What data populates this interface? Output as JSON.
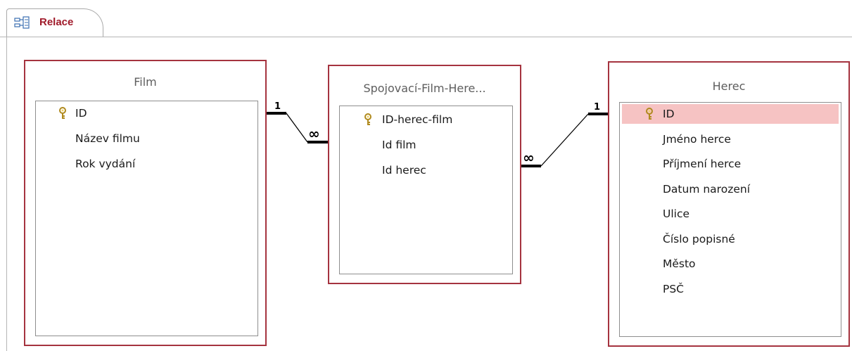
{
  "tab": {
    "label": "Relace"
  },
  "tables": {
    "film": {
      "title": "Film",
      "fields": [
        {
          "name": "ID",
          "key": true,
          "selected": false
        },
        {
          "name": "Název filmu",
          "key": false,
          "selected": false
        },
        {
          "name": "Rok vydání",
          "key": false,
          "selected": false
        }
      ]
    },
    "junction": {
      "title": "Spojovací-Film-Here...",
      "fields": [
        {
          "name": "ID-herec-film",
          "key": true,
          "selected": false
        },
        {
          "name": "Id film",
          "key": false,
          "selected": false
        },
        {
          "name": "Id herec",
          "key": false,
          "selected": false
        }
      ]
    },
    "herec": {
      "title": "Herec",
      "fields": [
        {
          "name": "ID",
          "key": true,
          "selected": true
        },
        {
          "name": "Jméno herce",
          "key": false,
          "selected": false
        },
        {
          "name": "Příjmení herce",
          "key": false,
          "selected": false
        },
        {
          "name": "Datum narození",
          "key": false,
          "selected": false
        },
        {
          "name": "Ulice",
          "key": false,
          "selected": false
        },
        {
          "name": "Číslo popisné",
          "key": false,
          "selected": false
        },
        {
          "name": "Město",
          "key": false,
          "selected": false
        },
        {
          "name": "PSČ",
          "key": false,
          "selected": false
        }
      ]
    }
  },
  "relationships": [
    {
      "from_table": "Film",
      "from_field": "ID",
      "from_label": "1",
      "to_table": "Spojovací-Film-Here...",
      "to_field": "Id film",
      "to_label": "∞"
    },
    {
      "from_table": "Herec",
      "from_field": "ID",
      "from_label": "1",
      "to_table": "Spojovací-Film-Here...",
      "to_field": "Id herec",
      "to_label": "∞"
    }
  ],
  "colors": {
    "table_border": "#a5333f",
    "selected_row": "#f6c3c3",
    "tab_text": "#a01a2a",
    "key_icon": "#c9a227"
  }
}
